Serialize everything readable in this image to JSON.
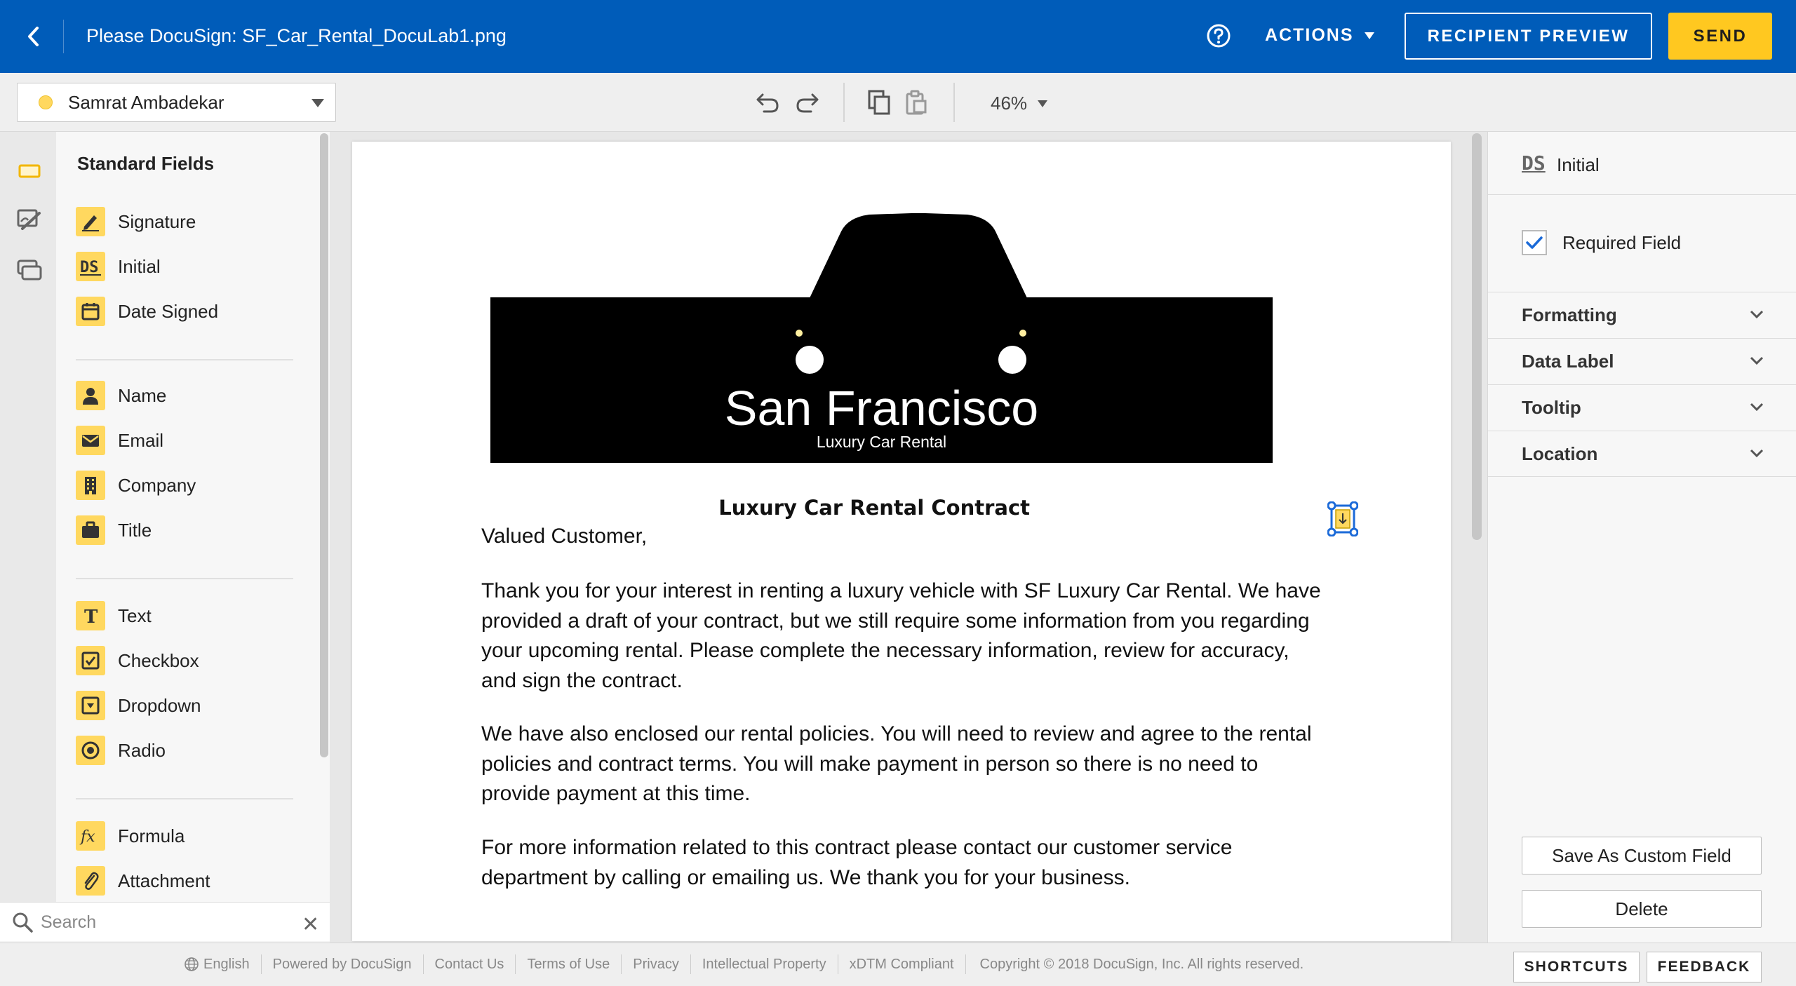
{
  "header": {
    "back_icon": "chevron-left-icon",
    "title": "Please DocuSign: SF_Car_Rental_DocuLab1.png",
    "help_icon": "question-circle-icon",
    "actions_label": "ACTIONS",
    "preview_label": "RECIPIENT PREVIEW",
    "send_label": "SEND",
    "brand_color": "#005cb9",
    "send_color": "#ffc820"
  },
  "toolbar": {
    "recipient_name": "Samrat Ambadekar",
    "recipient_color": "#ffd85f",
    "zoom": "46%"
  },
  "fields_panel": {
    "title": "Standard Fields",
    "groups": [
      [
        {
          "label": "Signature",
          "icon": "pen-icon"
        },
        {
          "label": "Initial",
          "icon": "ds-initial-icon"
        },
        {
          "label": "Date Signed",
          "icon": "calendar-icon"
        }
      ],
      [
        {
          "label": "Name",
          "icon": "person-icon"
        },
        {
          "label": "Email",
          "icon": "envelope-icon"
        },
        {
          "label": "Company",
          "icon": "building-icon"
        },
        {
          "label": "Title",
          "icon": "briefcase-icon"
        }
      ],
      [
        {
          "label": "Text",
          "icon": "text-t-icon"
        },
        {
          "label": "Checkbox",
          "icon": "checkbox-icon"
        },
        {
          "label": "Dropdown",
          "icon": "dropdown-icon"
        },
        {
          "label": "Radio",
          "icon": "radio-icon"
        }
      ],
      [
        {
          "label": "Formula",
          "icon": "fx-icon"
        },
        {
          "label": "Attachment",
          "icon": "paperclip-icon"
        }
      ]
    ],
    "search_placeholder": "Search"
  },
  "document": {
    "logo_city": "San Francisco",
    "logo_sub": "Luxury Car Rental",
    "heading": "Luxury Car Rental Contract",
    "greeting": "Valued Customer,",
    "paragraphs": [
      "Thank you for your interest in renting a luxury vehicle with SF Luxury Car Rental.  We have provided a draft of your contract, but we still require some information from you regarding your upcoming rental.  Please complete the necessary information, review for accuracy, and sign the contract.",
      "We have also enclosed our rental policies.  You will need to review and agree to the rental policies and contract terms.  You will make payment in person so there is no need to provide payment at this time.",
      "For more information related to this contract please contact our customer service department by calling or emailing us.  We thank you for your business."
    ]
  },
  "properties": {
    "field_type_badge": "DS",
    "field_type": "Initial",
    "required_label": "Required Field",
    "required_checked": true,
    "sections": [
      "Formatting",
      "Data Label",
      "Tooltip",
      "Location"
    ],
    "save_custom_label": "Save As Custom Field",
    "delete_label": "Delete"
  },
  "footer": {
    "language": "English",
    "links": [
      "Powered by DocuSign",
      "Contact Us",
      "Terms of Use",
      "Privacy",
      "Intellectual Property",
      "xDTM Compliant"
    ],
    "copyright": "Copyright © 2018 DocuSign, Inc. All rights reserved.",
    "shortcuts_label": "SHORTCUTS",
    "feedback_label": "FEEDBACK"
  }
}
